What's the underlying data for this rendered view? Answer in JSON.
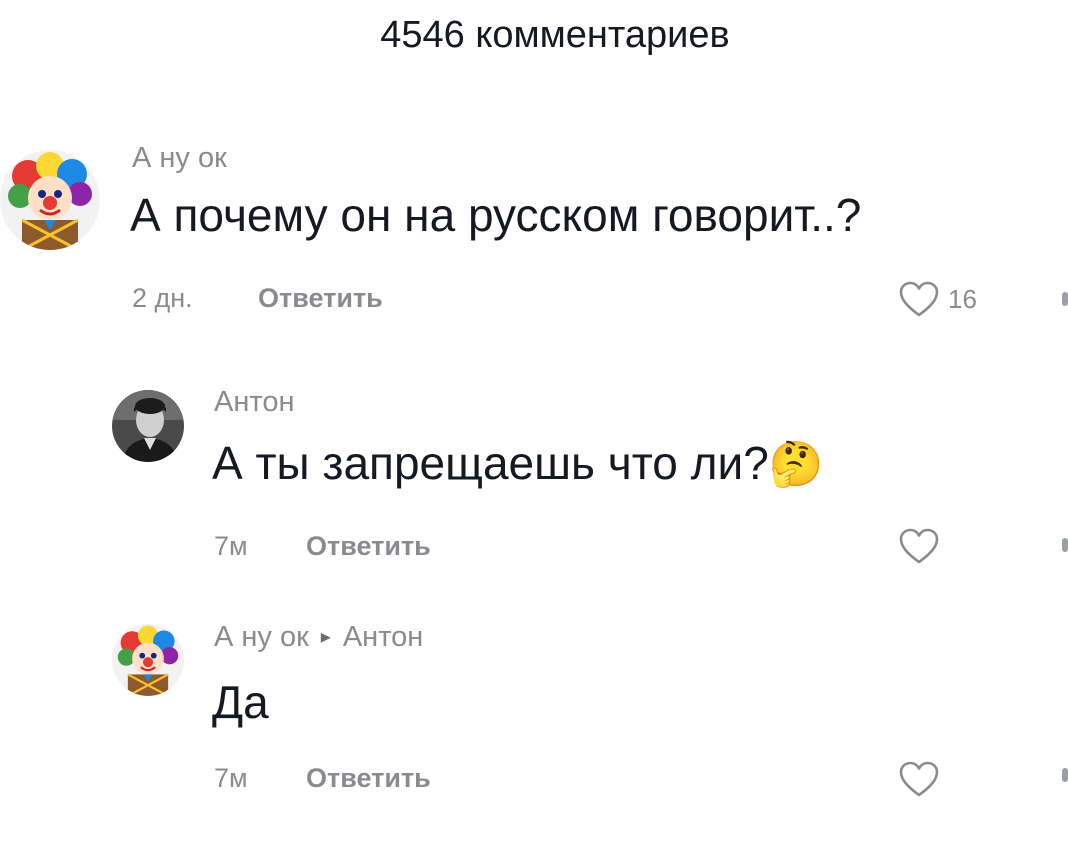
{
  "header": {
    "title": "4546 комментариев"
  },
  "comments": [
    {
      "username": "А ну ок",
      "text": "А почему он на русском говорит..?",
      "time": "2 дн.",
      "reply_label": "Ответить",
      "likes": "16",
      "avatar_icon": "clown-avatar-icon"
    },
    {
      "username": "Антон",
      "text": "А ты запрещаешь что ли?",
      "emoji": "🤔",
      "time": "7м",
      "reply_label": "Ответить",
      "avatar_icon": "man-portrait-avatar-icon"
    },
    {
      "username": "А ну ок",
      "reply_to_arrow": "▸",
      "reply_to": "Антон",
      "text": "Да",
      "time": "7м",
      "reply_label": "Ответить",
      "avatar_icon": "clown-avatar-icon"
    }
  ],
  "colors": {
    "text_primary": "#161823",
    "text_secondary": "#8a8b91"
  }
}
